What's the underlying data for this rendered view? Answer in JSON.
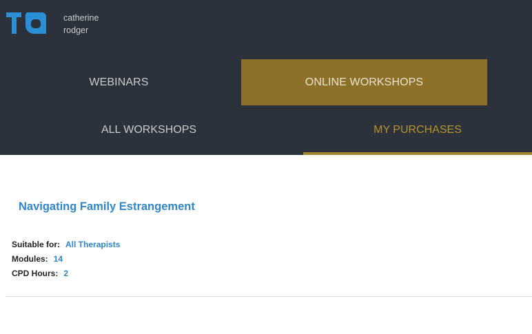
{
  "header": {
    "logo_text": "TA",
    "user": {
      "first_name": "catherine",
      "last_name": "rodger"
    }
  },
  "nav": {
    "primary": [
      {
        "label": "WEBINARS",
        "active": false
      },
      {
        "label": "ONLINE WORKSHOPS",
        "active": true
      }
    ],
    "secondary": [
      {
        "label": "ALL WORKSHOPS",
        "active": false
      },
      {
        "label": "MY PURCHASES",
        "active": true
      }
    ]
  },
  "course": {
    "title": "Navigating Family Estrangement",
    "details": [
      {
        "label": "Suitable for:",
        "value": "All Therapists"
      },
      {
        "label": "Modules:",
        "value": "14"
      },
      {
        "label": "CPD Hours:",
        "value": "2"
      }
    ]
  },
  "colors": {
    "topbar": "#2b323b",
    "accent_gold": "#8e7128",
    "link_blue": "#2f86c9",
    "logo_blue": "#2b8fd6"
  }
}
